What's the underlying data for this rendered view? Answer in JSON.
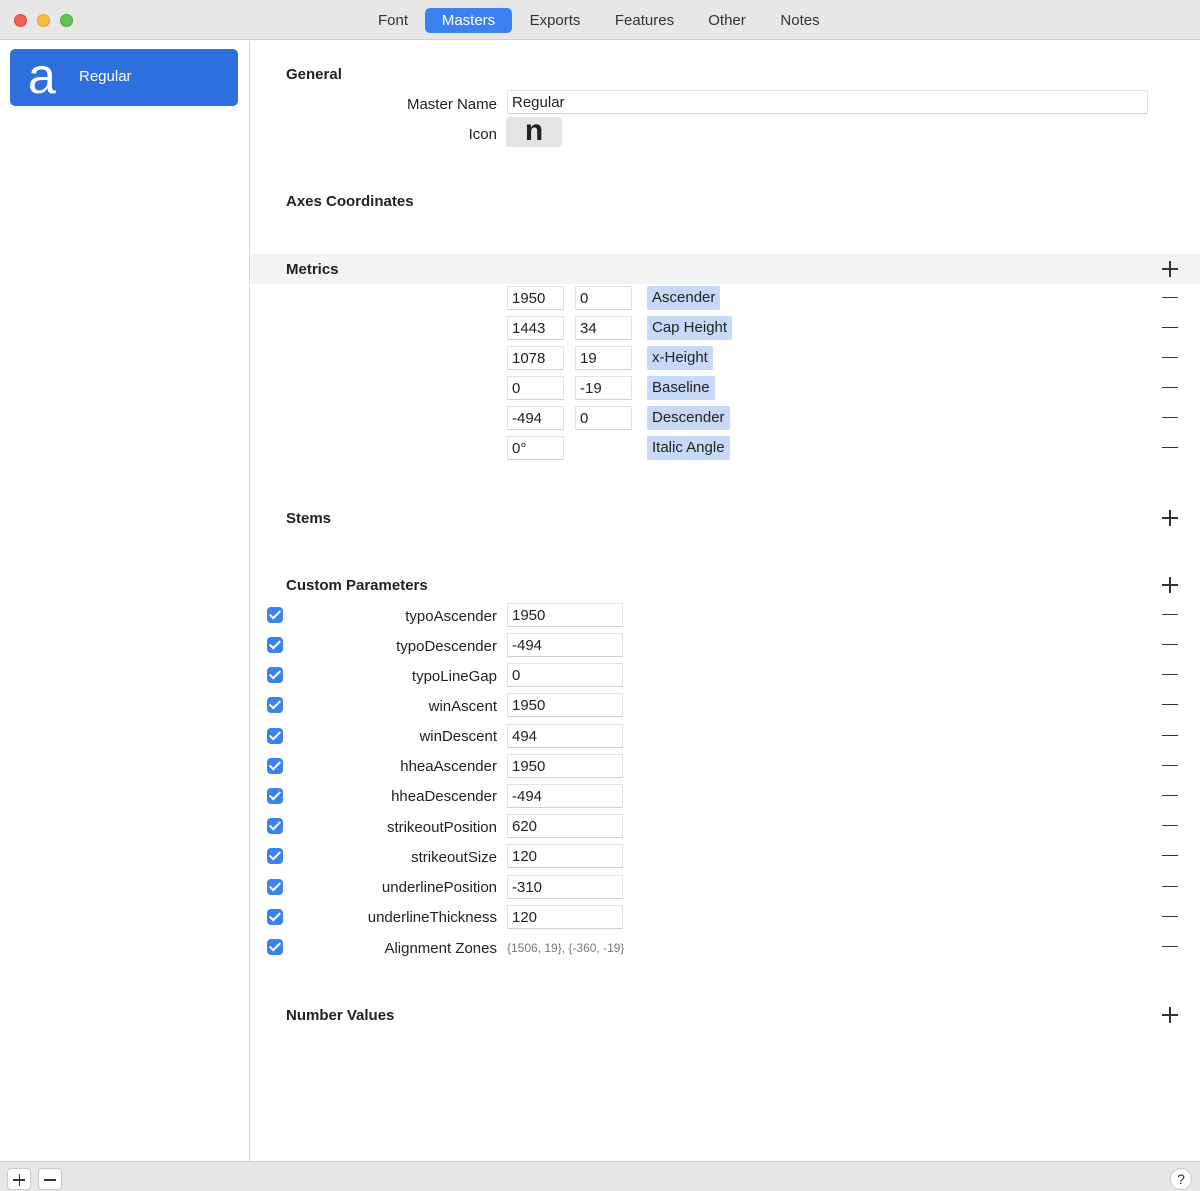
{
  "tabs": [
    "Font",
    "Masters",
    "Exports",
    "Features",
    "Other",
    "Notes"
  ],
  "active_tab": "Masters",
  "sidebar": {
    "master": {
      "glyph": "a",
      "label": "Regular"
    }
  },
  "general": {
    "title": "General",
    "master_name_label": "Master Name",
    "master_name_value": "Regular",
    "icon_label": "Icon",
    "icon_glyph": "n"
  },
  "axes": {
    "title": "Axes Coordinates"
  },
  "metrics": {
    "title": "Metrics",
    "rows": [
      {
        "value": "1950",
        "overshoot": "0",
        "name": "Ascender"
      },
      {
        "value": "1443",
        "overshoot": "34",
        "name": "Cap Height"
      },
      {
        "value": "1078",
        "overshoot": "19",
        "name": "x-Height"
      },
      {
        "value": "0",
        "overshoot": "-19",
        "name": "Baseline"
      },
      {
        "value": "-494",
        "overshoot": "0",
        "name": "Descender"
      },
      {
        "value": "0°",
        "overshoot": null,
        "name": "Italic Angle"
      }
    ]
  },
  "stems": {
    "title": "Stems"
  },
  "custom_parameters": {
    "title": "Custom Parameters",
    "rows": [
      {
        "checked": true,
        "name": "typoAscender",
        "value": "1950"
      },
      {
        "checked": true,
        "name": "typoDescender",
        "value": "-494"
      },
      {
        "checked": true,
        "name": "typoLineGap",
        "value": "0"
      },
      {
        "checked": true,
        "name": "winAscent",
        "value": "1950"
      },
      {
        "checked": true,
        "name": "winDescent",
        "value": "494"
      },
      {
        "checked": true,
        "name": "hheaAscender",
        "value": "1950"
      },
      {
        "checked": true,
        "name": "hheaDescender",
        "value": "-494"
      },
      {
        "checked": true,
        "name": "strikeoutPosition",
        "value": "620"
      },
      {
        "checked": true,
        "name": "strikeoutSize",
        "value": "120"
      },
      {
        "checked": true,
        "name": "underlinePosition",
        "value": "-310"
      },
      {
        "checked": true,
        "name": "underlineThickness",
        "value": "120"
      },
      {
        "checked": true,
        "name": "Alignment Zones",
        "value": "{1506, 19}, {-360, -19}"
      }
    ]
  },
  "number_values": {
    "title": "Number Values"
  },
  "bottom_bar": {
    "help_label": "?"
  },
  "colors": {
    "accent": "#3b82f0",
    "selection": "#2e6fde",
    "metric_tag": "#c7d9f7"
  }
}
